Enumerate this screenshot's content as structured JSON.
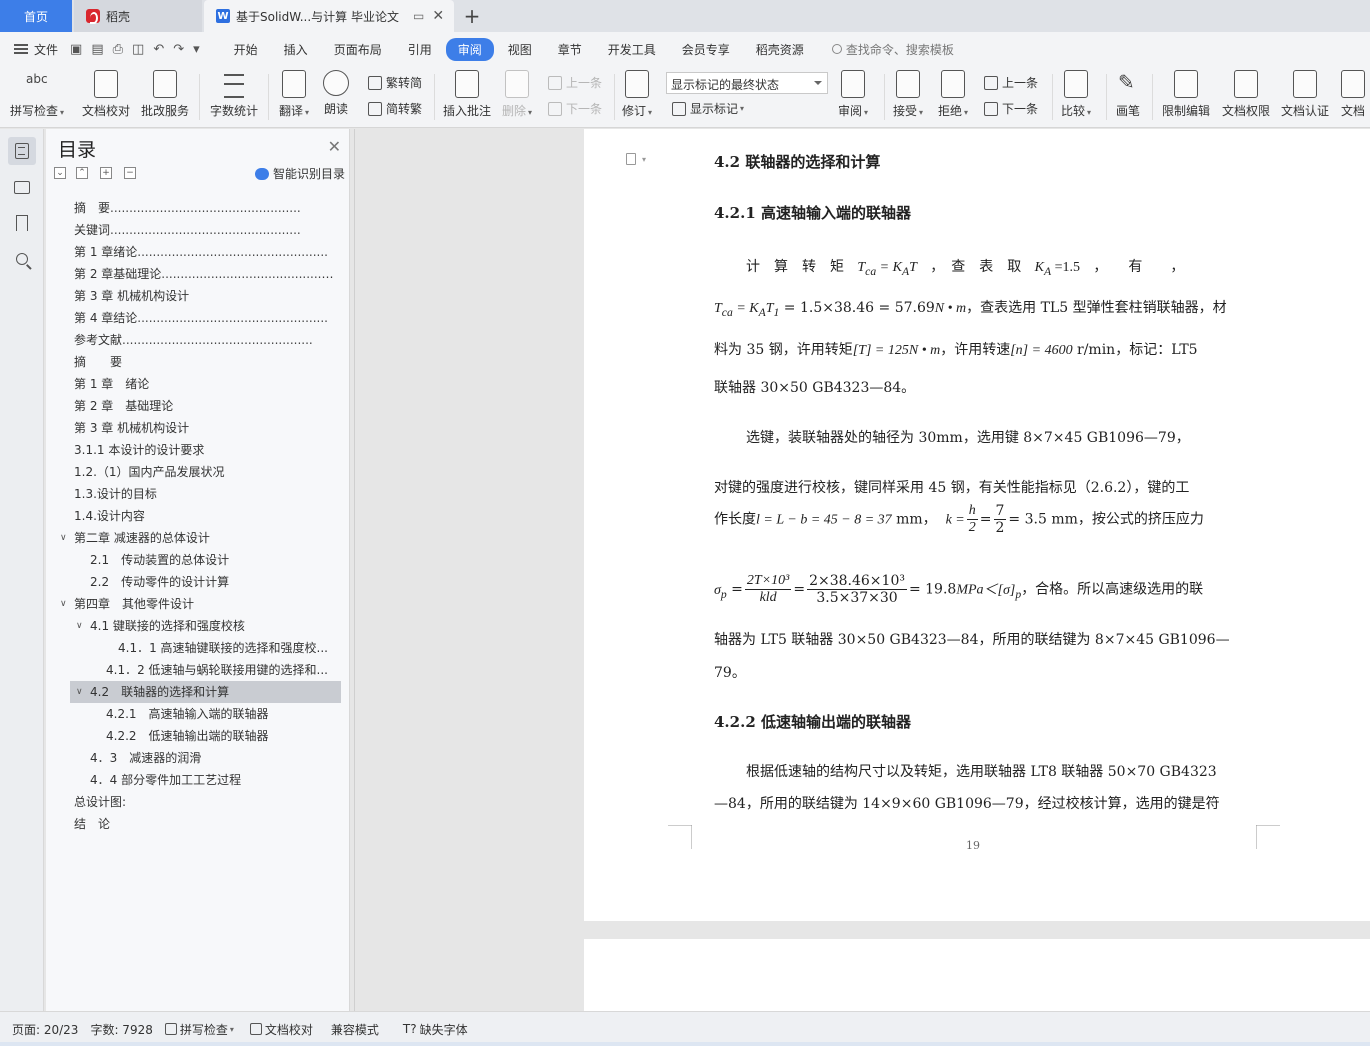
{
  "tabs": {
    "home": "首页",
    "daoke": "稻壳",
    "doc": "基于SolidW...与计算 毕业论文",
    "new_tab": "+"
  },
  "menu": {
    "file": "文件",
    "tabs": [
      "开始",
      "插入",
      "页面布局",
      "引用",
      "审阅",
      "视图",
      "章节",
      "开发工具",
      "会员专享",
      "稻壳资源"
    ],
    "active_tab": "审阅",
    "search_placeholder": "查找命令、搜索模板"
  },
  "ribbon": {
    "spellcheck": "拼写检查",
    "doc_proofread": "文档校对",
    "batch_revise": "批改服务",
    "word_count": "字数统计",
    "translate": "翻译",
    "read_aloud": "朗读",
    "trad_simp": "繁转简",
    "simp_trad": "简转繁",
    "insert_comment": "插入批注",
    "delete": "删除",
    "prev_comment": "上一条",
    "next_comment": "下一条",
    "track_changes": "修订",
    "markup_select": "显示标记的最终状态",
    "show_markup": "显示标记",
    "review": "审阅",
    "accept": "接受",
    "reject": "拒绝",
    "prev_change": "上一条",
    "next_change": "下一条",
    "compare": "比较",
    "pen": "画笔",
    "restrict_edit": "限制编辑",
    "doc_permission": "文档权限",
    "doc_certify": "文档认证",
    "doc_more": "文档"
  },
  "toc": {
    "title": "目录",
    "smart": "智能识别目录",
    "items": [
      {
        "text": "摘　要",
        "dots": "..................................................",
        "level": 0
      },
      {
        "text": "关键词",
        "dots": "..................................................",
        "level": 0
      },
      {
        "text": "第 1 章绪论",
        "dots": "..................................................",
        "level": 0
      },
      {
        "text": "第 2 章基础理论",
        "dots": "..................................................",
        "level": 0
      },
      {
        "text": "第 3 章 机械机构设计",
        "dots": "",
        "level": 0
      },
      {
        "text": "第 4 章结论",
        "dots": "..................................................",
        "level": 0
      },
      {
        "text": "参考文献",
        "dots": "..................................................",
        "level": 0
      },
      {
        "text": "摘　　要",
        "dots": "",
        "level": 0
      },
      {
        "text": "第 1 章　绪论",
        "dots": "",
        "level": 0
      },
      {
        "text": "第 2 章　基础理论",
        "dots": "",
        "level": 0
      },
      {
        "text": "第 3 章  机械机构设计",
        "dots": "",
        "level": 0
      },
      {
        "text": "3.1.1  本设计的设计要求",
        "dots": "",
        "level": 0
      },
      {
        "text": "1.2.（1）国内产品发展状况",
        "dots": "",
        "level": 0
      },
      {
        "text": "1.3.设计的目标",
        "dots": "",
        "level": 0
      },
      {
        "text": "1.4.设计内容",
        "dots": "",
        "level": 0
      },
      {
        "text": "第二章  减速器的总体设计",
        "dots": "",
        "level": 0,
        "toggle": "v"
      },
      {
        "text": "2.1　传动装置的总体设计",
        "dots": "",
        "level": 1
      },
      {
        "text": "2.2　传动零件的设计计算",
        "dots": "",
        "level": 1
      },
      {
        "text": "第四章　其他零件设计",
        "dots": "",
        "level": 0,
        "toggle": "v"
      },
      {
        "text": "4.1 键联接的选择和强度校核",
        "dots": "",
        "level": 1,
        "toggle": "v"
      },
      {
        "text": "4.1．1 高速轴键联接的选择和强度校...",
        "dots": "",
        "level": 3
      },
      {
        "text": "4.1．2 低速轴与蜗轮联接用键的选择和...",
        "dots": "",
        "level": 2
      },
      {
        "text": "4.2　联轴器的选择和计算",
        "dots": "",
        "level": 1,
        "toggle": "v",
        "selected": true
      },
      {
        "text": "4.2.1　高速轴输入端的联轴器",
        "dots": "",
        "level": 2
      },
      {
        "text": "4.2.2　低速轴输出端的联轴器",
        "dots": "",
        "level": 2
      },
      {
        "text": "4．3　减速器的润滑",
        "dots": "",
        "level": 1
      },
      {
        "text": "4．4 部分零件加工工艺过程",
        "dots": "",
        "level": 1
      },
      {
        "text": "总设计图:",
        "dots": "",
        "level": 0
      },
      {
        "text": "结　论",
        "dots": "",
        "level": 0
      }
    ]
  },
  "doc": {
    "h_42": "4.2   联轴器的选择和计算",
    "h_421": "4.2.1   高速轴输入端的联轴器",
    "l1_a": "计　算　转　矩",
    "l1_formula": "T",
    "l1_formula_sub": "ca",
    "l1_eq": " = K",
    "l1_eq_sub": "A",
    "l1_eq_tail": "T",
    "l1_b": "，　查　表　取",
    "l1_ka": "K",
    "l1_ka_sub": "A",
    "l1_ka_val": " =1.5",
    "l1_c": "，　　有　　，",
    "l2_formula": "T",
    "l2_sub": "ca",
    "l2_mid": " = K",
    "l2_mid_sub": "A",
    "l2_t1": "T",
    "l2_t1_sub": "1",
    "l2_calc": " = 1.5×38.46 = 57.69",
    "l2_unit": "N • m",
    "l2_text": "，查表选用 TL5 型弹性套柱销联轴器，材",
    "l3_a": "料为 35 钢，许用转矩",
    "l3_t": "[T] = 125",
    "l3_unit": "N • m",
    "l3_b": "，许用转速",
    "l3_n": "[n] = 4600",
    "l3_c": " r/min，标记：LT5",
    "l4": "联轴器 30×50 GB4323—84。",
    "l5": "选键，装联轴器处的轴径为 30mm，选用键 8×7×45 GB1096—79，",
    "l6": "对键的强度进行校核，键同样采用 45 钢，有关性能指标见（2.6.2），键的工",
    "l7_a": "作长度",
    "l7_formula": "l = L − b = 45 − 8 = 37",
    "l7_b": " mm，",
    "l7_k": "k =",
    "l7_h": "h",
    "l7_2": "2",
    "l7_eq": "=",
    "l7_7": "7",
    "l7_2b": "2",
    "l7_val": "= 3.5",
    "l7_c": " mm，按公式的挤压应力",
    "l8_sigma": "σ",
    "l8_sub": "p",
    "l8_eq": " =",
    "l8_num1": "2T×10³",
    "l8_den1": "kld",
    "l8_eq2": "=",
    "l8_num2": "2×38.46×10³",
    "l8_den2": "3.5×37×30",
    "l8_val": "= 19.8",
    "l8_unit": "MPa",
    "l8_lt": "＜[σ]",
    "l8_lt_sub": "p",
    "l8_text": "，合格。所以高速级选用的联",
    "l9": "轴器为 LT5 联轴器 30×50 GB4323—84，所用的联结键为 8×7×45 GB1096—",
    "l10": "79。",
    "h_422": "4.2.2   低速轴输出端的联轴器",
    "l11": "根据低速轴的结构尺寸以及转矩，选用联轴器 LT8 联轴器 50×70   GB4323",
    "l12": "—84，所用的联结键为 14×9×60 GB1096—79，经过校核计算，选用的键是符",
    "page_number": "19"
  },
  "status": {
    "page": "页面: 20/23",
    "words": "字数: 7928",
    "spellcheck": "拼写检查",
    "proofread": "文档校对",
    "compat": "兼容模式",
    "missing_font": "缺失字体"
  },
  "colors": {
    "accent": "#3d7ee8",
    "toc_selected": "#c9ccd2"
  }
}
